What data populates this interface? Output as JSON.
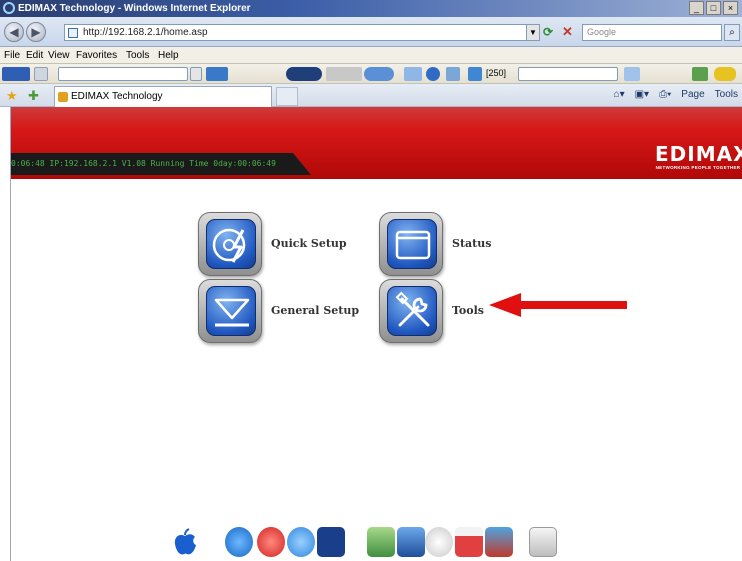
{
  "window": {
    "title": "EDIMAX Technology - Windows Internet Explorer",
    "minimize_glyph": "_",
    "restore_glyph": "□",
    "close_glyph": "×"
  },
  "address_bar": {
    "url": "http://192.168.2.1/home.asp",
    "search_placeholder": "Google",
    "back_glyph": "◀",
    "forward_glyph": "▶",
    "dropdown_glyph": "▼",
    "refresh_glyph": "⟳",
    "stop_glyph": "✕",
    "search_glyph": "⌕"
  },
  "menu": {
    "items": [
      "File",
      "Edit",
      "View",
      "Favorites",
      "Tools",
      "Help"
    ]
  },
  "toolbar": {
    "counter": "[250]"
  },
  "tabs": {
    "active_label": "EDIMAX Technology"
  },
  "command_bar": {
    "items": [
      "Page",
      "Tools"
    ]
  },
  "router_ui": {
    "status_text": "0:06:48  IP:192.168.2.1  V1.08  Running Time 0day:00:06:49",
    "logo_wordmark": "EDIMAX",
    "logo_tagline": "NETWORKING PEOPLE TOGETHER",
    "nav": [
      {
        "label": "Quick Setup",
        "icon": "disc-lightning-icon"
      },
      {
        "label": "Status",
        "icon": "window-icon"
      },
      {
        "label": "General Setup",
        "icon": "eject-icon"
      },
      {
        "label": "Tools",
        "icon": "wrench-screwdriver-icon"
      }
    ]
  },
  "annotation": {
    "arrow_color": "#e01010",
    "points_to": "Tools"
  },
  "colors": {
    "banner_red": "#c41010",
    "status_green": "#4bb04b",
    "nav_blue": "#2057c0"
  }
}
